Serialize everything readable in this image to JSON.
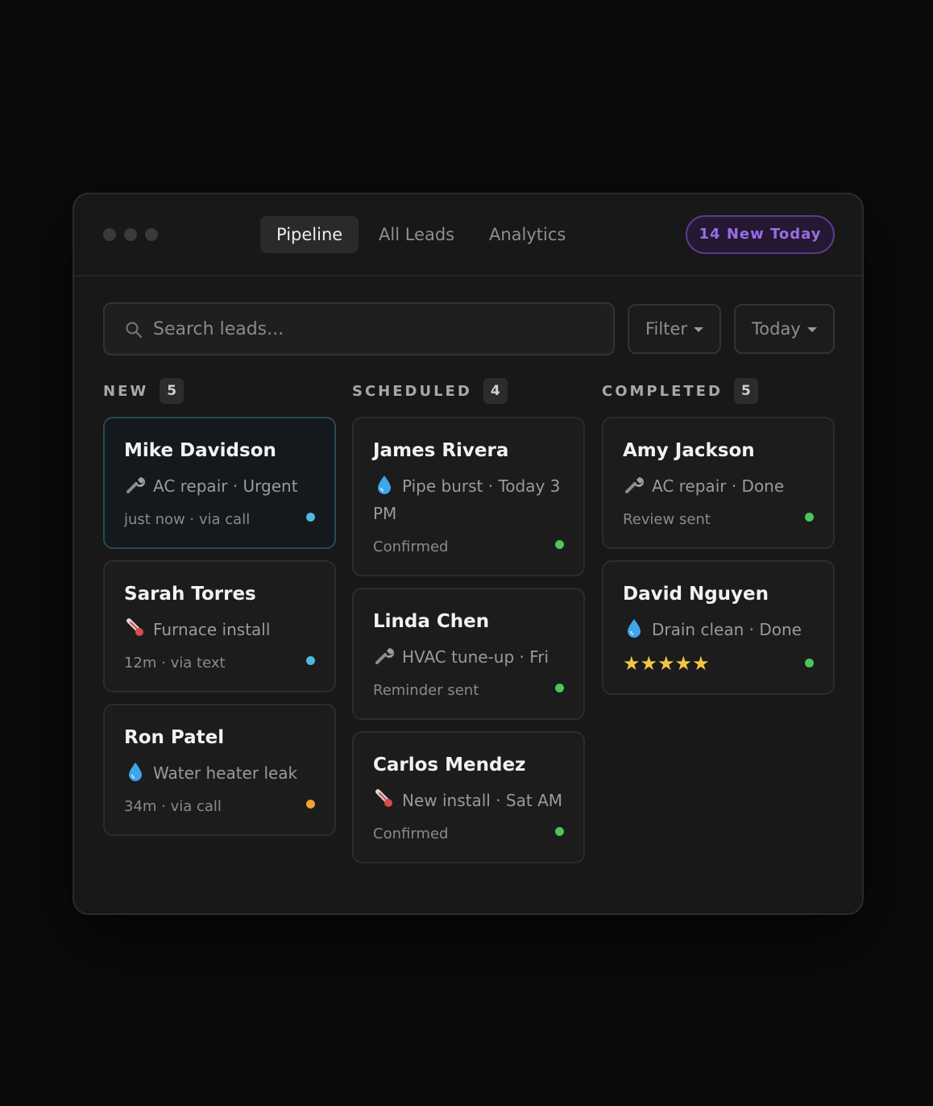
{
  "app": {
    "tabs": [
      {
        "label": "Pipeline",
        "active": true
      },
      {
        "label": "All Leads",
        "active": false
      },
      {
        "label": "Analytics",
        "active": false
      }
    ],
    "new_today_badge": "14 New Today"
  },
  "toolbar": {
    "search_placeholder": "Search leads...",
    "filter_label": "Filter",
    "date_label": "Today"
  },
  "columns": [
    {
      "title": "NEW",
      "count": "5",
      "cards": [
        {
          "name": "Mike Davidson",
          "icon": "wrench-icon",
          "detail": "AC repair · Urgent",
          "footer": "just now · via call",
          "status_color": "#4fb8e0",
          "highlighted": true
        },
        {
          "name": "Sarah Torres",
          "icon": "thermometer-icon",
          "detail": "Furnace install",
          "footer": "12m · via text",
          "status_color": "#4fb8e0"
        },
        {
          "name": "Ron Patel",
          "icon": "droplet-icon",
          "detail": "Water heater leak",
          "footer": "34m · via call",
          "status_color": "#f0a030"
        }
      ]
    },
    {
      "title": "SCHEDULED",
      "count": "4",
      "cards": [
        {
          "name": "James Rivera",
          "icon": "droplet-icon",
          "detail": "Pipe burst · Today 3 PM",
          "footer": "Confirmed",
          "status_color": "#4cc55a"
        },
        {
          "name": "Linda Chen",
          "icon": "wrench-icon",
          "detail": "HVAC tune-up · Fri",
          "footer": "Reminder sent",
          "status_color": "#4cc55a"
        },
        {
          "name": "Carlos Mendez",
          "icon": "thermometer-icon",
          "detail": "New install · Sat AM",
          "footer": "Confirmed",
          "status_color": "#4cc55a"
        }
      ]
    },
    {
      "title": "COMPLETED",
      "count": "5",
      "cards": [
        {
          "name": "Amy Jackson",
          "icon": "wrench-icon",
          "detail": "AC repair · Done",
          "footer": "Review sent",
          "status_color": "#4cc55a"
        },
        {
          "name": "David Nguyen",
          "icon": "droplet-icon",
          "detail": "Drain clean · Done",
          "footer": "★★★★★",
          "rating": 5,
          "status_color": "#4cc55a"
        }
      ]
    }
  ]
}
